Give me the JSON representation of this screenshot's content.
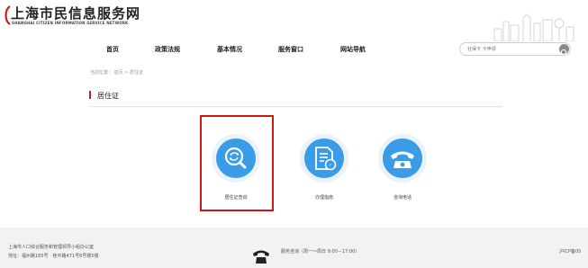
{
  "header": {
    "logo_title": "上海市民信息服务网",
    "logo_subtitle": "SHANGHAI CITIZEN INFORMATION SERVICE NETWORK"
  },
  "nav": {
    "items": [
      {
        "label": "首页"
      },
      {
        "label": "政策法规"
      },
      {
        "label": "基本情况"
      },
      {
        "label": "服务窗口"
      },
      {
        "label": "网站导航"
      }
    ]
  },
  "search": {
    "placeholder": "社保卡 卡申领"
  },
  "breadcrumb": "当前位置： 首页 > 居住证",
  "section": {
    "title": "居住证"
  },
  "tiles": [
    {
      "label": "居住证查询",
      "icon": "search-refresh-icon"
    },
    {
      "label": "办理指南",
      "icon": "document-compass-icon"
    },
    {
      "label": "咨询电话",
      "icon": "telephone-icon"
    }
  ],
  "footer": {
    "line1": "上海市人口综合服务和管理领导小组办公室",
    "line2": "地址：福州路185号　桂平路471号6号楼5楼",
    "hours": "服务咨询（周一～周日 9:00－17:00）",
    "icp": "沪ICP备05"
  },
  "colors": {
    "accent": "#3a9be6",
    "highlight": "#d21414",
    "section_bar": "#c41e24"
  }
}
